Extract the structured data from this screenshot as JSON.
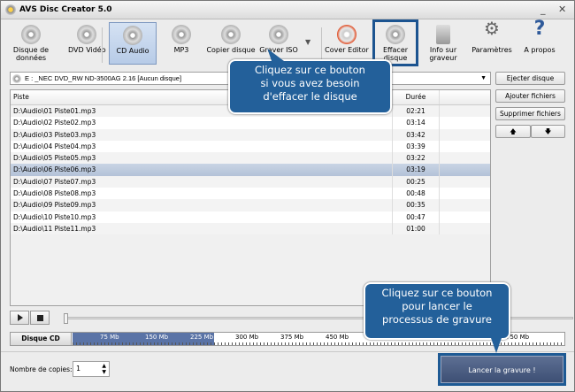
{
  "window": {
    "title": "AVS Disc Creator 5.0",
    "minimize": "_",
    "close": "✕"
  },
  "toolbar": [
    {
      "id": "data",
      "label": "Disque de\ndonnées",
      "icon": "data-disc-icon"
    },
    {
      "id": "dvd",
      "label": "DVD Vidéo",
      "icon": "dvd-video-icon"
    },
    {
      "id": "cd",
      "label": "CD Audio",
      "icon": "cd-audio-icon",
      "active": true
    },
    {
      "id": "mp3",
      "label": "MP3",
      "icon": "mp3-icon"
    },
    {
      "id": "copy",
      "label": "Copier disque",
      "icon": "copy-disc-icon"
    },
    {
      "id": "iso",
      "label": "Graver ISO",
      "icon": "burn-iso-icon"
    },
    {
      "id": "cover",
      "label": "Cover Editor",
      "icon": "cover-editor-icon"
    },
    {
      "id": "erase",
      "label": "Effacer\ndisque",
      "icon": "erase-disc-icon",
      "highlighted": true
    },
    {
      "id": "info",
      "label": "Info sur\ngraveur",
      "icon": "burner-info-icon"
    },
    {
      "id": "settings",
      "label": "Paramètres",
      "icon": "gear-icon"
    },
    {
      "id": "about",
      "label": "A propos",
      "icon": "question-icon"
    }
  ],
  "drive": {
    "value": "E : _NEC     DVD_RW ND-3500AG 2.16     [Aucun disque]"
  },
  "buttons": {
    "eject": "Ejecter disque",
    "add": "Ajouter fichiers",
    "remove": "Supprimer fichiers",
    "up": "🡅",
    "down": "🡇"
  },
  "table": {
    "columns": [
      "Piste",
      "Durée"
    ],
    "rows": [
      [
        "D:\\Audio\\01 Piste01.mp3",
        "02:21"
      ],
      [
        "D:\\Audio\\02 Piste02.mp3",
        "03:14"
      ],
      [
        "D:\\Audio\\03 Piste03.mp3",
        "03:42"
      ],
      [
        "D:\\Audio\\04 Piste04.mp3",
        "03:39"
      ],
      [
        "D:\\Audio\\05 Piste05.mp3",
        "03:22"
      ],
      [
        "D:\\Audio\\06 Piste06.mp3",
        "03:19"
      ],
      [
        "D:\\Audio\\07 Piste07.mp3",
        "00:25"
      ],
      [
        "D:\\Audio\\08 Piste08.mp3",
        "00:48"
      ],
      [
        "D:\\Audio\\09 Piste09.mp3",
        "00:35"
      ],
      [
        "D:\\Audio\\10 Piste10.mp3",
        "00:47"
      ],
      [
        "D:\\Audio\\11 Piste11.mp3",
        "01:00"
      ]
    ],
    "selected_index": 5
  },
  "disk": {
    "label": "Disque CD",
    "used_mb": 235,
    "max_mb": 800,
    "ticks": [
      "75 Mb",
      "150 Mb",
      "225 Mb",
      "300 Mb",
      "375 Mb",
      "450 Mb",
      "750 Mb"
    ],
    "fill_color": "#5a73a6"
  },
  "copies": {
    "label": "Nombre de copies:",
    "value": "1"
  },
  "burn": {
    "label": "Lancer la gravure !"
  },
  "callouts": {
    "erase": [
      "Cliquez sur ce bouton",
      "si vous avez besoin",
      "d'effacer le disque"
    ],
    "burn": [
      "Cliquez sur ce bouton",
      "pour lancer le",
      "processus de gravure"
    ],
    "color": "#23609a"
  }
}
